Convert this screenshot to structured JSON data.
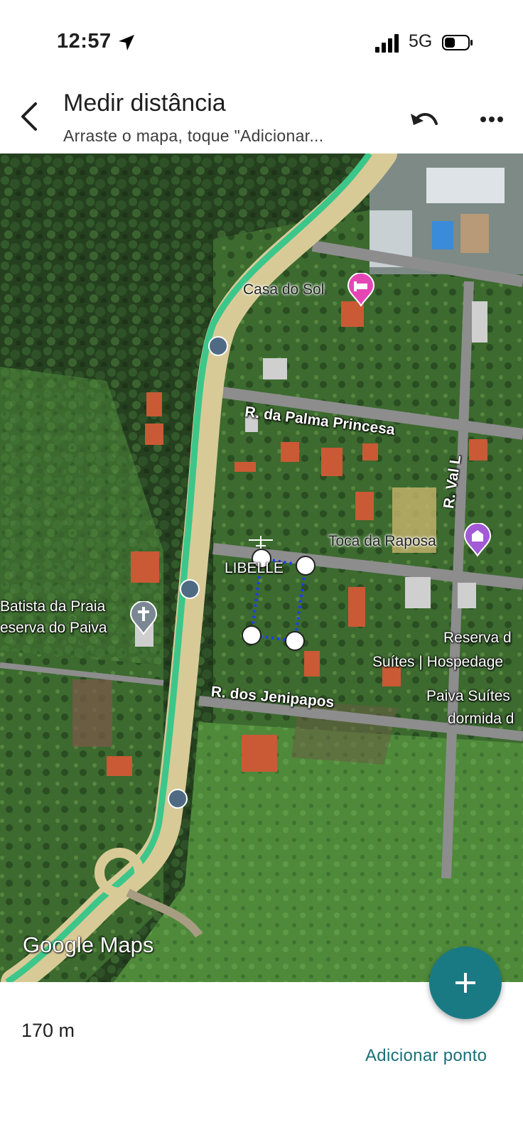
{
  "status": {
    "time": "12:57",
    "network": "5G",
    "location_icon": "location-arrow-icon",
    "signal_icon": "signal-bars-icon",
    "battery_icon": "battery-icon"
  },
  "header": {
    "title": "Medir distância",
    "subtitle": "Arraste o mapa, toque \"Adicionar...",
    "back_icon": "back-arrow-icon",
    "undo_icon": "undo-icon",
    "more_icon": "more-vert-icon"
  },
  "map": {
    "labels": {
      "casa_do_sol": "Casa do Sol",
      "palma_princesa": "R. da Palma Princesa",
      "val_l": "R. Val L",
      "toca_raposa": "Toca da Raposa",
      "libelle": "LIBELLE",
      "batista_1": "Batista da Praia",
      "batista_2": "eserva do Paiva",
      "reserva_1": "Reserva d",
      "reserva_2": "Suítes | Hospedage",
      "jenipapos": "R. dos Jenipapos",
      "paiva_1": "Paiva Suítes",
      "paiva_2": "dormida d"
    },
    "attribution": "Google Maps",
    "colors": {
      "route": "#3cc68a",
      "road": "#d8ca96",
      "measure_line": "#1a3cff",
      "poi_pink": "#e645b4",
      "poi_purple": "#a35ad6",
      "poi_gray": "#7b8792",
      "bus": "#4f6b83"
    }
  },
  "bottom": {
    "distance": "170 m",
    "add_point_label": "Adicionar ponto",
    "fab_icon": "plus-icon",
    "fab_color": "#1a7a84"
  }
}
